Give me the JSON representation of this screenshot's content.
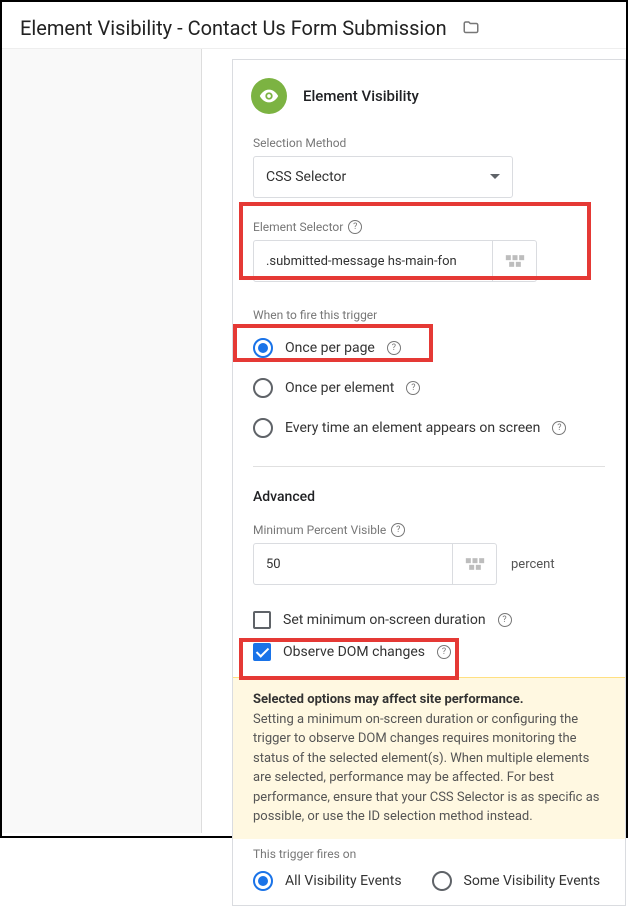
{
  "header": {
    "title": "Element Visibility - Contact Us Form Submission"
  },
  "card": {
    "title": "Element Visibility"
  },
  "selectionMethod": {
    "label": "Selection Method",
    "value": "CSS Selector"
  },
  "elementSelector": {
    "label": "Element Selector",
    "value": ".submitted-message hs-main-fon"
  },
  "whenToFire": {
    "label": "When to fire this trigger",
    "options": [
      {
        "label": "Once per page",
        "checked": true
      },
      {
        "label": "Once per element",
        "checked": false
      },
      {
        "label": "Every time an element appears on screen",
        "checked": false
      }
    ]
  },
  "advanced": {
    "heading": "Advanced",
    "minPercent": {
      "label": "Minimum Percent Visible",
      "value": "50",
      "unit": "percent"
    },
    "minDuration": {
      "label": "Set minimum on-screen duration",
      "checked": false
    },
    "observeDom": {
      "label": "Observe DOM changes",
      "checked": true
    }
  },
  "warning": {
    "title": "Selected options may affect site performance.",
    "body": "Setting a minimum on-screen duration or configuring the trigger to observe DOM changes requires monitoring the status of the selected element(s). When multiple elements are selected, performance may be affected. For best performance, ensure that your CSS Selector is as specific as possible, or use the ID selection method instead."
  },
  "firesOn": {
    "label": "This trigger fires on",
    "options": [
      {
        "label": "All Visibility Events",
        "checked": true
      },
      {
        "label": "Some Visibility Events",
        "checked": false
      }
    ]
  }
}
